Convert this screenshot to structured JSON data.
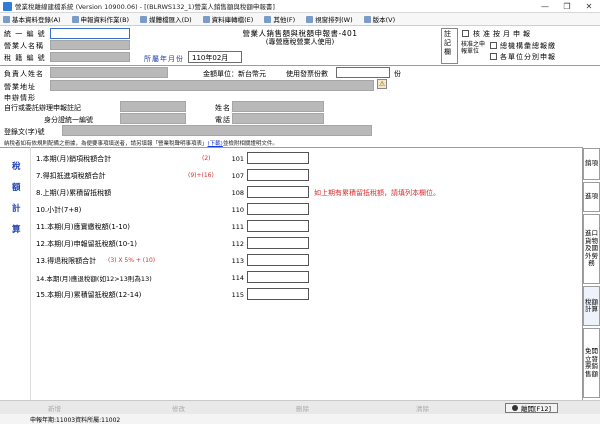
{
  "titlebar": {
    "title": "營業稅離線建檔系統 (Version 10900.06) - [(BLRWS132_1)營業人銷售額與稅額申報書]",
    "minimize": "—",
    "restore": "❐",
    "close": "✕"
  },
  "menu": [
    {
      "label": "基本資料登錄(A)",
      "icon": "database-icon"
    },
    {
      "label": "申報資料作業(B)",
      "icon": "document-icon"
    },
    {
      "label": "媒體檔匯入(D)",
      "icon": "import-icon"
    },
    {
      "label": "資料庫轉檔(E)",
      "icon": "convert-icon"
    },
    {
      "label": "其他(F)",
      "icon": "misc-icon"
    },
    {
      "label": "視窗排列(W)",
      "icon": "window-icon"
    },
    {
      "label": "版本(V)",
      "icon": "info-icon"
    }
  ],
  "header": {
    "tax_id_label": "統 一 編 號",
    "biz_name_label": "營業人名稱",
    "tax_reg_label": "稅 籍 編 號",
    "form_title": "營業人銷售額與稅額申報書-401",
    "form_subtitle": "(專營應稅營業人使用)",
    "period_label": "所屬年月份",
    "period_value": "110年02月",
    "note_label": "註記欄",
    "option1": "核准按月申報",
    "option2": "總機構彙總報繳",
    "option3": "各單位分別申報",
    "approved_label": "核准之申報單位"
  },
  "info": {
    "owner_label": "負責人姓名",
    "currency_label": "金額單位：新台幣元",
    "invoice_label": "使用發票份數",
    "invoice_suffix": "份",
    "address_label": "營業地址",
    "declare_label": "申辦情形",
    "agent_label": "自行或委託辦理申報註記",
    "name_label": "姓名",
    "id_label": "身分證統一編號",
    "phone_label": "電話",
    "doc_label": "登錄文(字)號"
  },
  "note": {
    "text": "納稅者如有依規則配備之冊據，為便要事項填送者，請另填報「營業稅聲明事項表」",
    "link": "(下載)",
    "tail": "並檢附相關證明文件。"
  },
  "section": {
    "chars": [
      "稅",
      "額",
      "計",
      "算"
    ]
  },
  "rows": [
    {
      "label": "1.本期(月)銷項稅額合計",
      "ref": "(2)",
      "code": "101"
    },
    {
      "label": "7.得扣抵進項稅額合計",
      "ref": "(9)+(16)",
      "code": "107"
    },
    {
      "label": "8.上期(月)累積留抵稅額",
      "ref": "",
      "code": "108",
      "hint": "如上期有累積留抵稅額，請填列本欄位。"
    },
    {
      "label": "10.小計(7+8)",
      "ref": "",
      "code": "110"
    },
    {
      "label": "11.本期(月)應實繳稅額(1-10)",
      "ref": "",
      "code": "111"
    },
    {
      "label": "12.本期(月)申報留抵稅額(10-1)",
      "ref": "",
      "code": "112"
    },
    {
      "label": "13.得退稅限額合計",
      "ref": "(3) X 5% + (10)",
      "code": "113"
    },
    {
      "label": "14.本期(月)應退稅額(如12>13則為13)",
      "ref": "",
      "code": "114"
    },
    {
      "label": "15.本期(月)累積留抵稅額(12-14)",
      "ref": "",
      "code": "115"
    }
  ],
  "tabs": [
    {
      "label": "銷項",
      "active": false
    },
    {
      "label": "進項",
      "active": false
    },
    {
      "label": "進口貨物及國外勞務",
      "active": false
    },
    {
      "label": "稅額計算",
      "active": true
    },
    {
      "label": "免開立發票銷售額",
      "active": false
    }
  ],
  "buttons": {
    "add": "新增",
    "edit": "修改",
    "delete": "刪除",
    "clear": "清除",
    "exit": "離開[F12]"
  },
  "status": {
    "text": "申報年期:11003資料所屬:11002"
  },
  "colors": {
    "accent": "#3a6fcf",
    "link": "#1a3bd6",
    "red": "#d63030",
    "gray_field": "#b9b9b9"
  }
}
